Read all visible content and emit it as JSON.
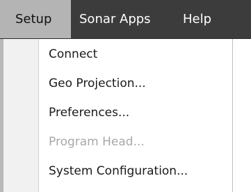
{
  "menubar": {
    "items": [
      {
        "label": "Setup",
        "active": true
      },
      {
        "label": "Sonar Apps",
        "active": false
      },
      {
        "label": "Help",
        "active": false
      }
    ]
  },
  "setup_menu": {
    "items": [
      {
        "label": "Connect",
        "enabled": true
      },
      {
        "label": "Geo Projection...",
        "enabled": true
      },
      {
        "label": "Preferences...",
        "enabled": true
      },
      {
        "label": "Program Head...",
        "enabled": false
      },
      {
        "label": "System Configuration...",
        "enabled": true
      }
    ]
  },
  "colors": {
    "menubar_bg": "#3c3c3c",
    "active_menu_bg": "#b4b4b4",
    "disabled_text": "#a8a8a8"
  }
}
